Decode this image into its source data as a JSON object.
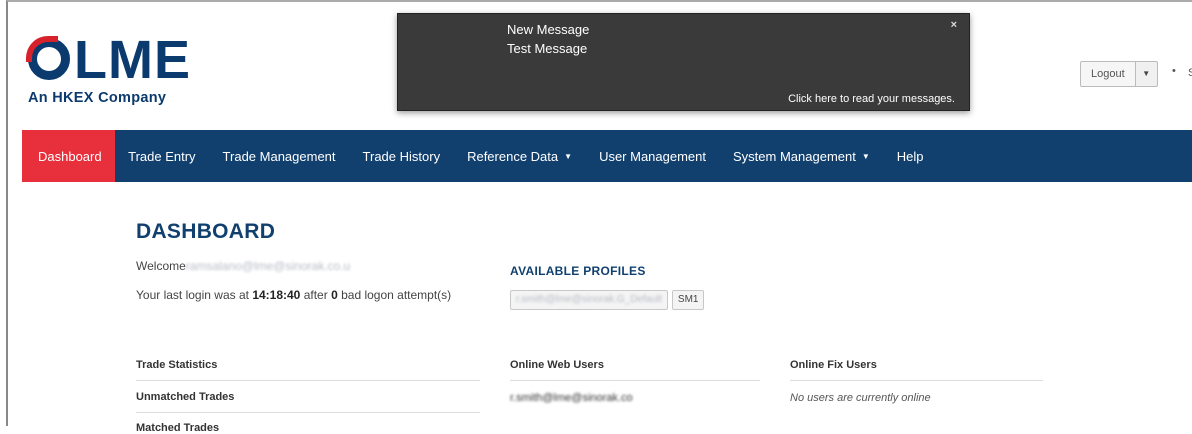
{
  "logo": {
    "text": "LME",
    "subtitle": "An HKEX Company"
  },
  "notification": {
    "title": "New Message",
    "body": "Test Message",
    "close": "×",
    "link": "Click here to read your messages."
  },
  "header": {
    "logout_label": "Logout",
    "caret": "▼",
    "bullet": "•",
    "edge_text_1": "S",
    "edge_text_2": "SA"
  },
  "nav": {
    "items": [
      {
        "label": "Dashboard",
        "active": true
      },
      {
        "label": "Trade Entry"
      },
      {
        "label": "Trade Management"
      },
      {
        "label": "Trade History"
      },
      {
        "label": "Reference Data",
        "dropdown": true
      },
      {
        "label": "User Management"
      },
      {
        "label": "System Management",
        "dropdown": true
      },
      {
        "label": "Help"
      }
    ],
    "caret": "▼"
  },
  "dashboard": {
    "title": "DASHBOARD",
    "welcome_prefix": "Welcome",
    "welcome_user": "ramsalano@lme@sinorak.co.u",
    "last_login_prefix": "Your last login was at",
    "last_login_time": "14:18:40",
    "last_login_mid": "after",
    "bad_logons": "0",
    "last_login_suffix": "bad logon attempt(s)"
  },
  "profiles": {
    "title": "AVAILABLE PROFILES",
    "items": [
      {
        "label": "r.smith@lme@sinorak.G_Default"
      },
      {
        "label": "SM1"
      }
    ]
  },
  "trade_statistics": {
    "header": "Trade Statistics",
    "rows": [
      "Unmatched Trades",
      "Matched Trades"
    ]
  },
  "online_web_users": {
    "header": "Online Web Users",
    "rows": [
      "r.smith@lme@sinorak.co"
    ]
  },
  "online_fix_users": {
    "header": "Online Fix Users",
    "empty_message": "No users are currently online"
  }
}
